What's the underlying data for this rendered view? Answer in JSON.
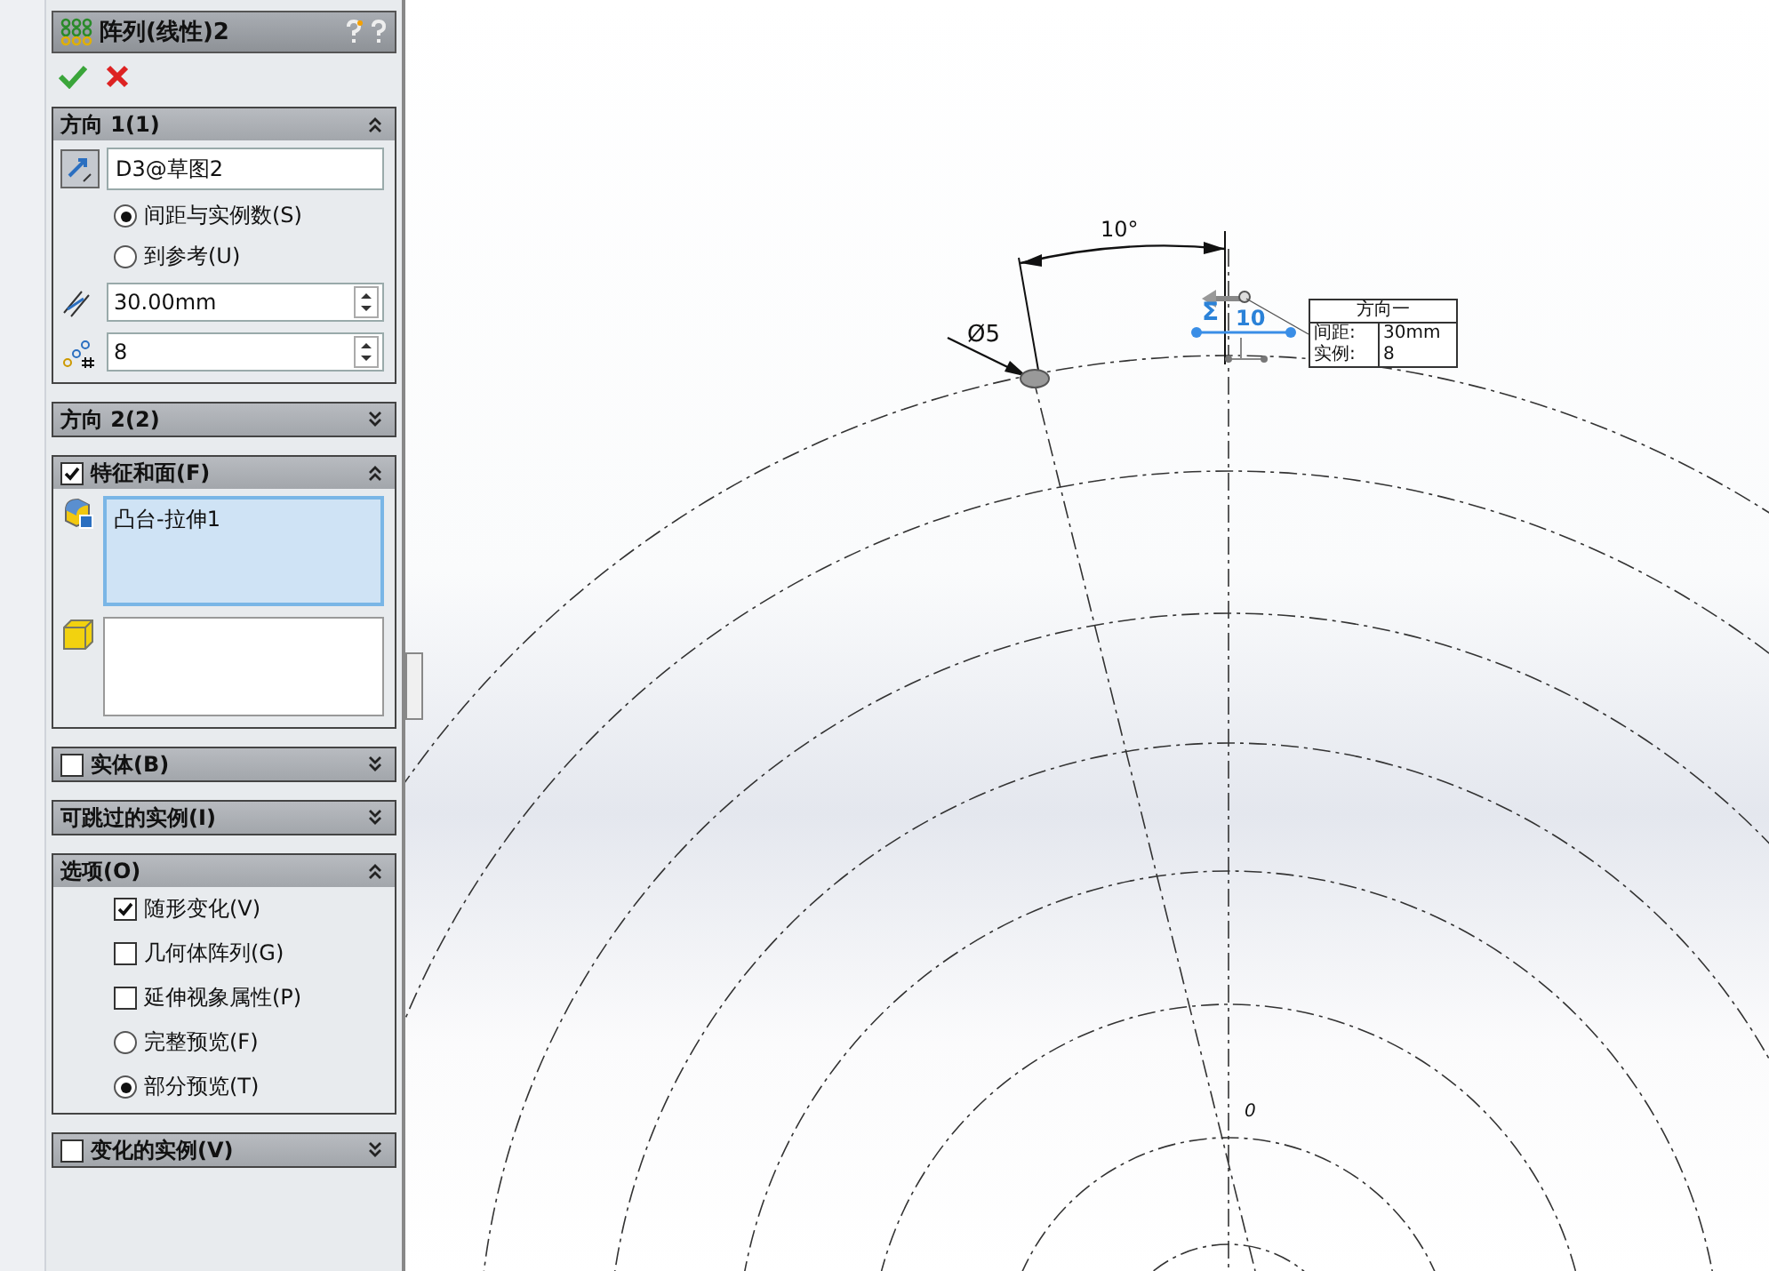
{
  "panel": {
    "title": "阵列(线性)2",
    "sections": [
      {
        "kind": "direction",
        "title": "方向 1(1)",
        "expanded": true,
        "reference": "D3@草图2",
        "radios": [
          {
            "label": "间距与实例数(S)",
            "selected": true
          },
          {
            "label": "到参考(U)",
            "selected": false
          }
        ],
        "spacing": "30.00mm",
        "count": "8"
      },
      {
        "kind": "plain",
        "title": "方向 2(2)",
        "expanded": false
      },
      {
        "kind": "features",
        "title": "特征和面(F)",
        "expanded": true,
        "checked": true,
        "features": [
          "凸台-拉伸1"
        ]
      },
      {
        "kind": "plain",
        "title": "实体(B)",
        "expanded": false,
        "checked": false
      },
      {
        "kind": "plain",
        "title": "可跳过的实例(I)",
        "expanded": false
      },
      {
        "kind": "options",
        "title": "选项(O)",
        "expanded": true,
        "items": [
          {
            "kind": "checkbox",
            "label": "随形变化(V)",
            "checked": true
          },
          {
            "kind": "checkbox",
            "label": "几何体阵列(G)",
            "checked": false
          },
          {
            "kind": "checkbox",
            "label": "延伸视象属性(P)",
            "checked": false
          },
          {
            "kind": "radio",
            "label": "完整预览(F)",
            "selected": false
          },
          {
            "kind": "radio",
            "label": "部分预览(T)",
            "selected": true
          }
        ]
      },
      {
        "kind": "plain",
        "title": "变化的实例(V)",
        "expanded": false,
        "checked": false
      }
    ]
  },
  "canvas": {
    "angle_dimension": "10°",
    "diameter_dimension": "Ø5",
    "pattern_symbol": "Σ",
    "pattern_count": "10",
    "origin_label": "0",
    "tooltip": {
      "title": "方向一",
      "rows": [
        {
          "label": "间距:",
          "value": "30mm"
        },
        {
          "label": "实例:",
          "value": "8"
        }
      ]
    }
  }
}
